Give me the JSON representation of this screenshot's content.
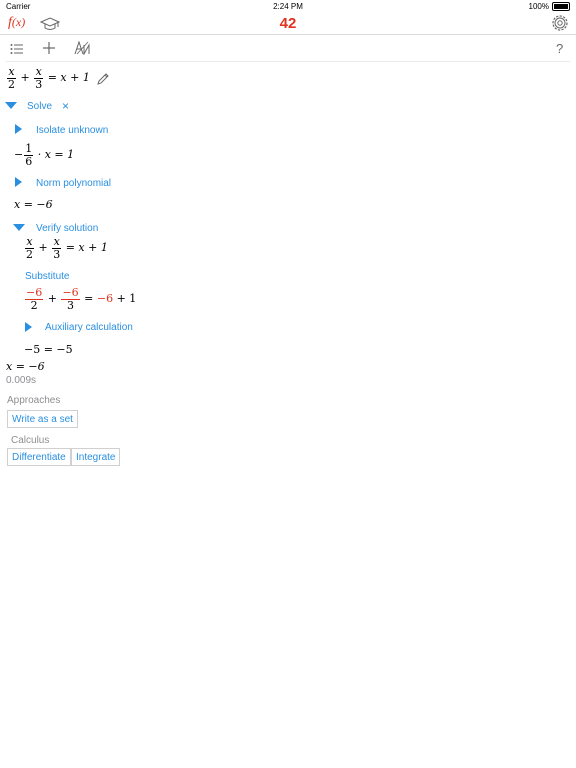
{
  "status_bar": {
    "carrier": "Carrier",
    "time": "2:24 PM",
    "battery": "100%"
  },
  "header": {
    "logo_f": "f",
    "logo_x": "(x)",
    "counter": "42"
  },
  "toolbar": {
    "help": "?"
  },
  "equation": {
    "x": "x",
    "two": "2",
    "plus": "+",
    "three": "3",
    "rhs": "= x + 1"
  },
  "solve": {
    "label": "Solve",
    "close_symbol": "×",
    "isolate_label": "Isolate unknown",
    "isolate_result": {
      "minus": "−",
      "one": "1",
      "six": "6",
      "rest": "· x = 1"
    },
    "norm_label": "Norm polynomial",
    "norm_result": "x = −6",
    "verify_label": "Verify solution",
    "verify_eq": {
      "x": "x",
      "two": "2",
      "plus": "+",
      "three": "3",
      "rhs": "= x + 1"
    },
    "substitute_label": "Substitute",
    "substitute_eq": {
      "m6": "−6",
      "two": "2",
      "plus": "+",
      "three": "3",
      "eq": "=",
      "m6b": "−6",
      "rest": "+ 1"
    },
    "aux_label": "Auxiliary calculation",
    "verify_result": "−5 = −5",
    "final_result": "x = −6",
    "time": "0.009s"
  },
  "approaches": {
    "heading": "Approaches",
    "buttons": [
      "Write as a set"
    ]
  },
  "calculus": {
    "heading": "Calculus",
    "buttons": [
      "Differentiate",
      "Integrate"
    ]
  },
  "colors": {
    "accent_blue": "#2a8fe0",
    "accent_red": "#e0321f",
    "muted": "#8e8e93"
  }
}
